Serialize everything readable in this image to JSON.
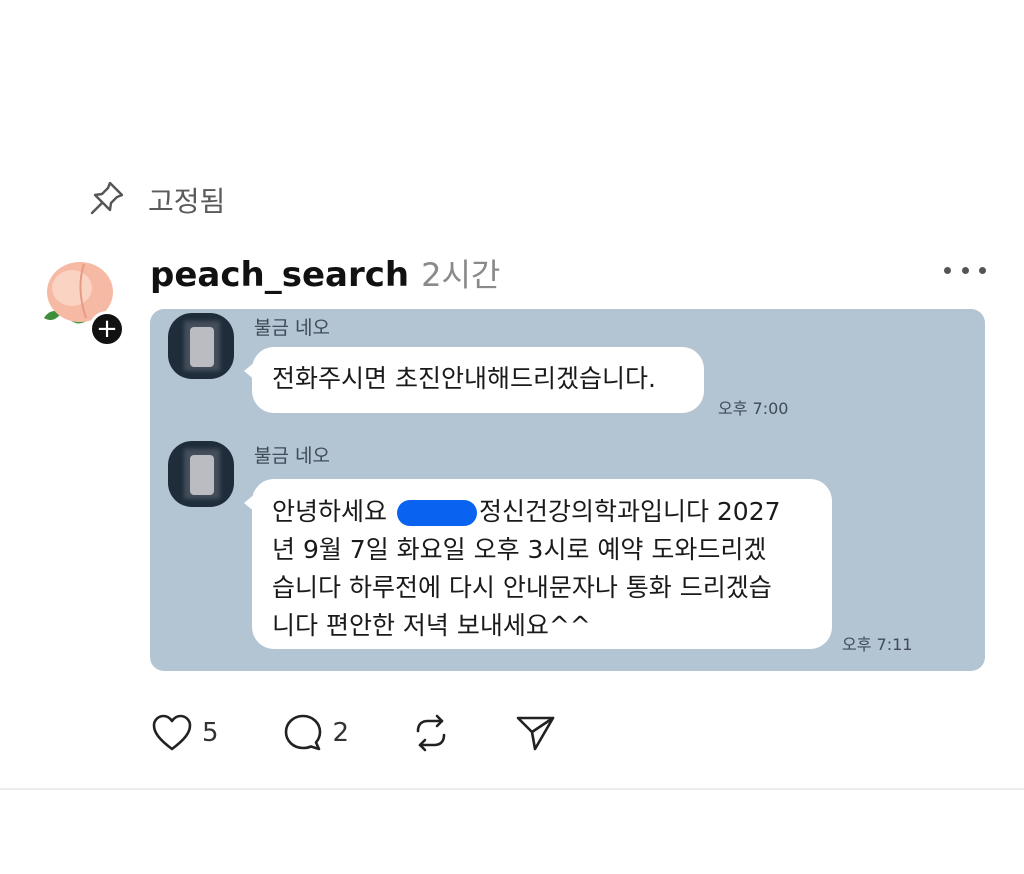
{
  "pinned": {
    "label": "고정됨",
    "icon": "pin-icon"
  },
  "post": {
    "username": "peach_search",
    "time": "2시간",
    "more_icon": "more-icon",
    "avatar_icon": "peach-icon",
    "follow_icon": "plus-icon"
  },
  "chat": {
    "background": "#b3c4d3",
    "messages": [
      {
        "sender": "불금 네오",
        "text": "전화주시면 초진안내해드리겠습니다.",
        "time": "오후 7:00"
      },
      {
        "sender": "불금 네오",
        "text_before_redaction": "안녕하세요 ",
        "text_line1_after": "정신건강의학과입니다 2027",
        "text_line2": "년 9월 7일 화요일 오후 3시로 예약 도와드리겠",
        "text_line3": "습니다 하루전에 다시 안내문자나 통화 드리겠습",
        "text_line4": "니다 편안한 저녁 보내세요^^",
        "time": "오후 7:11"
      }
    ]
  },
  "actions": {
    "like_count": "5",
    "comment_count": "2",
    "like_icon": "heart-icon",
    "comment_icon": "comment-icon",
    "repost_icon": "repost-icon",
    "share_icon": "send-icon"
  }
}
